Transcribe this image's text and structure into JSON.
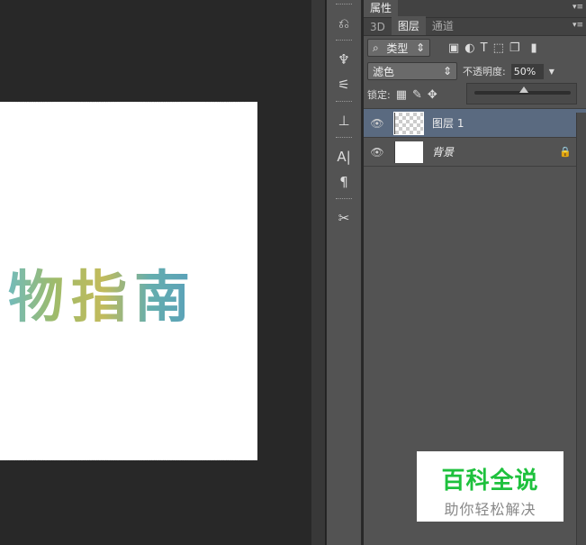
{
  "canvas": {
    "artwork_text": "物指南"
  },
  "properties_panel": {
    "tab": "属性"
  },
  "layers_panel": {
    "tabs": [
      "3D",
      "图层",
      "通道"
    ],
    "filter_kind": "类型",
    "blend_mode": "滤色",
    "opacity_label": "不透明度:",
    "opacity_value": "50%",
    "opacity_percent": 50,
    "lock_label": "锁定:",
    "layers": [
      {
        "name": "图层 1",
        "selected": true
      },
      {
        "name": "背景",
        "locked": true
      }
    ]
  },
  "watermark": {
    "title": "百科全说",
    "subtitle": "助你轻松解决"
  }
}
